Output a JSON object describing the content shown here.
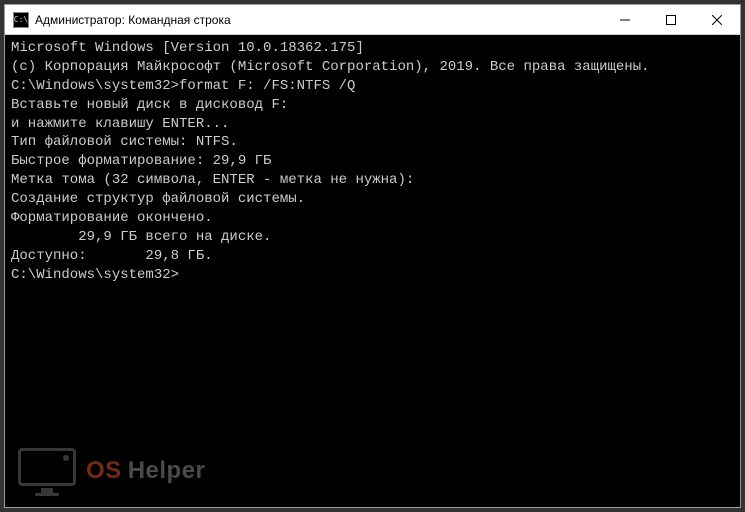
{
  "titlebar": {
    "icon_label": "C:\\",
    "title": "Администратор: Командная строка"
  },
  "terminal": {
    "lines": [
      "Microsoft Windows [Version 10.0.18362.175]",
      "(c) Корпорация Майкрософт (Microsoft Corporation), 2019. Все права защищены.",
      "",
      "C:\\Windows\\system32>format F: /FS:NTFS /Q",
      "Вставьте новый диск в дисковод F:",
      "и нажмите клавишу ENTER...",
      "Тип файловой системы: NTFS.",
      "Быстрое форматирование: 29,9 ГБ",
      "Метка тома (32 символа, ENTER - метка не нужна):",
      "Создание структур файловой системы.",
      "Форматирование окончено.",
      "        29,9 ГБ всего на диске.",
      "Доступно:       29,8 ГБ.",
      "",
      "C:\\Windows\\system32>"
    ]
  },
  "watermark": {
    "part1": "OS",
    "part2": "Helper"
  }
}
